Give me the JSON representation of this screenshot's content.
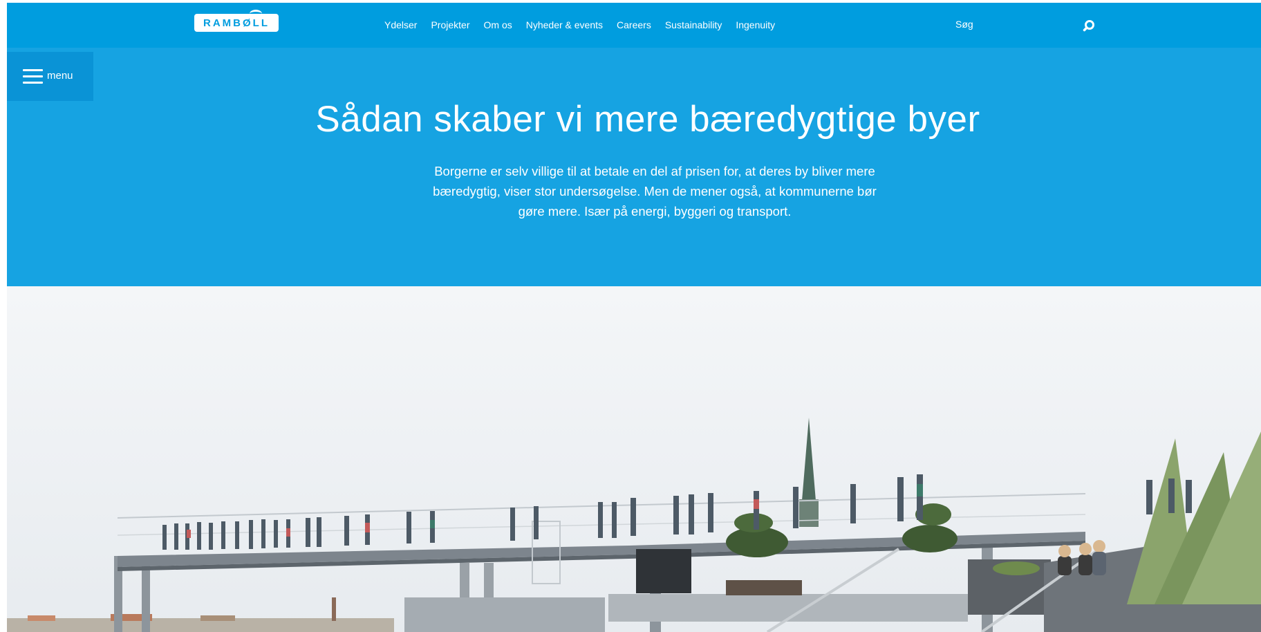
{
  "brand": {
    "logo_text": "RAMBØLL"
  },
  "nav": {
    "items": [
      {
        "label": "Ydelser"
      },
      {
        "label": "Projekter"
      },
      {
        "label": "Om os"
      },
      {
        "label": "Nyheder & events"
      },
      {
        "label": "Careers"
      },
      {
        "label": "Sustainability"
      },
      {
        "label": "Ingenuity"
      }
    ]
  },
  "search": {
    "label": "Søg",
    "icon": "search-icon"
  },
  "menu": {
    "label": "menu",
    "icon": "hamburger-icon"
  },
  "hero": {
    "title": "Sådan skaber vi mere bæredygtige byer",
    "intro": "Borgerne er selv villige til at betale en del af prisen for, at deres by bliver mere bæredygtig, viser stor undersøgelse. Men de mener også, at kommunerne bør gøre mere. Især på energi, byggeri og transport."
  },
  "colors": {
    "topbar": "#009ddf",
    "hero": "#16a3e2",
    "menu_button": "#0a93d6",
    "text": "#ffffff"
  }
}
